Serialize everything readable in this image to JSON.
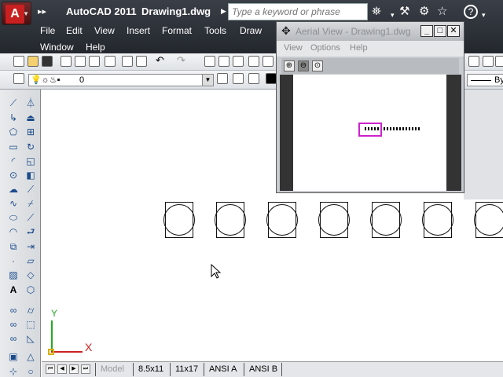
{
  "titlebar": {
    "app_title": "AutoCAD 2011",
    "doc_title": "Drawing1.dwg",
    "search_placeholder": "Type a keyword or phrase"
  },
  "menu": [
    "File",
    "Edit",
    "View",
    "Insert",
    "Format",
    "Tools",
    "Draw",
    "Window",
    "Help"
  ],
  "layer": {
    "current": "0"
  },
  "properties": {
    "lineweight": "By"
  },
  "aerial_view": {
    "title": "Aerial View - Drawing1.dwg",
    "menu": [
      "View",
      "Options",
      "Help"
    ]
  },
  "ucs": {
    "x_label": "X",
    "y_label": "Y"
  },
  "layout_tabs": [
    "Model",
    "8.5x11",
    "11x17",
    "ANSI A",
    "ANSI B"
  ]
}
